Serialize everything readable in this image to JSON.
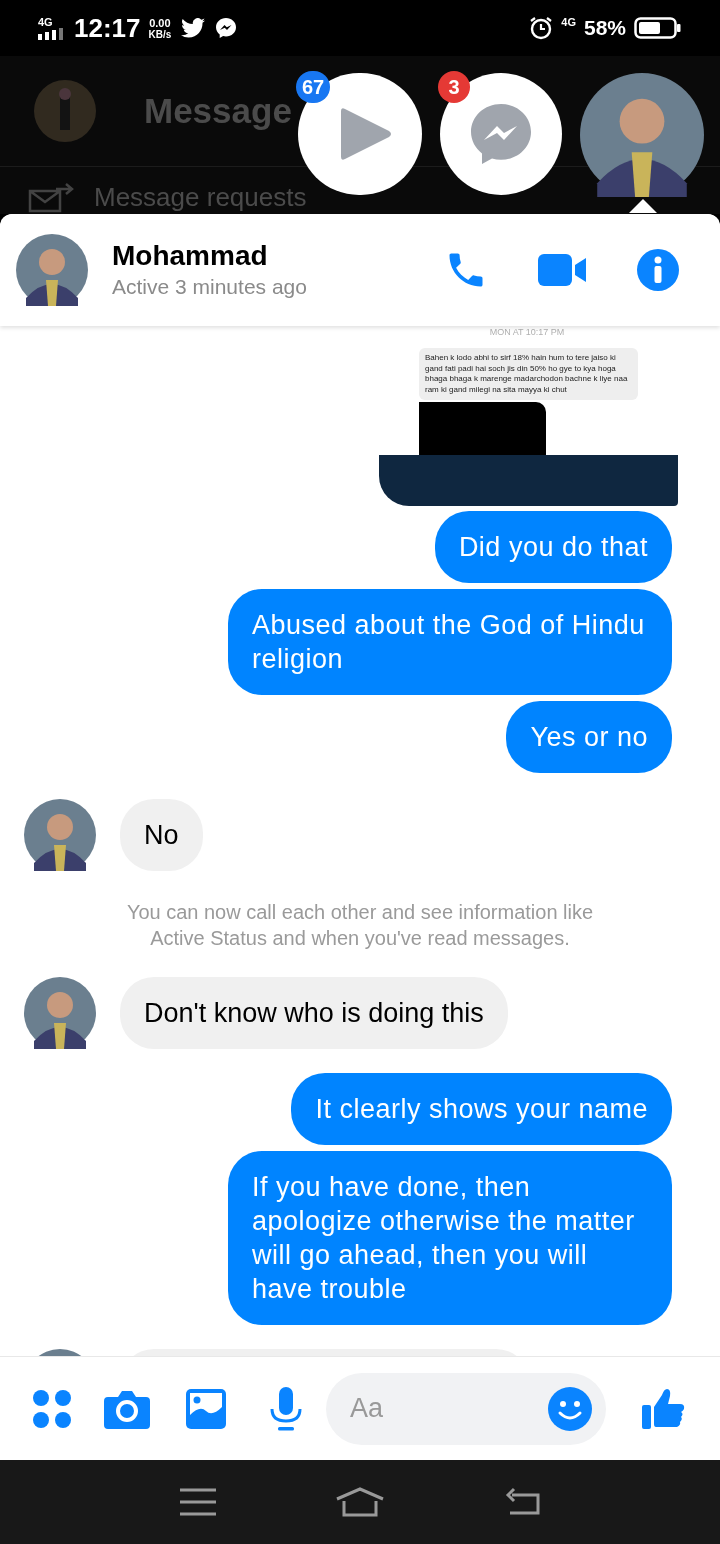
{
  "status_bar": {
    "network": "4G",
    "time": "12:17",
    "speed_value": "0.00",
    "speed_unit": "KB/s",
    "network_right": "4G",
    "battery": "58%"
  },
  "background": {
    "title": "Message",
    "requests": "Message requests"
  },
  "chat_heads": [
    {
      "kind": "video",
      "badge": "67"
    },
    {
      "kind": "messenger",
      "badge": "3"
    },
    {
      "kind": "avatar",
      "selected": true
    }
  ],
  "header": {
    "name": "Mohammad",
    "status": "Active 3 minutes ago"
  },
  "messages": [
    {
      "kind": "image",
      "timestamp": "MON AT 10:17 PM",
      "text": "Bahen k lodo abhi to sirf 18% hain hum to tere jaiso ki gand fati padi hai soch jis din 50% ho gye to kya hoga bhaga bhaga k marenge madarchodon bachne k liye naa ram ki gand milegi na sita mayya ki chut"
    },
    {
      "kind": "sent",
      "text": "Did you do that"
    },
    {
      "kind": "sent",
      "text": "Abused about the God of Hindu religion"
    },
    {
      "kind": "sent",
      "text": "Yes or no"
    },
    {
      "kind": "received",
      "text": "No"
    },
    {
      "kind": "info",
      "text": "You can now call each other and see information like Active Status and when you've read messages."
    },
    {
      "kind": "received",
      "text": "Don't know who is doing this"
    },
    {
      "kind": "sent",
      "text": "It clearly shows your name"
    },
    {
      "kind": "sent",
      "text": "If you have done, then apologize otherwise the matter will go ahead, then you will have trouble"
    }
  ],
  "composer": {
    "placeholder": "Aa"
  }
}
